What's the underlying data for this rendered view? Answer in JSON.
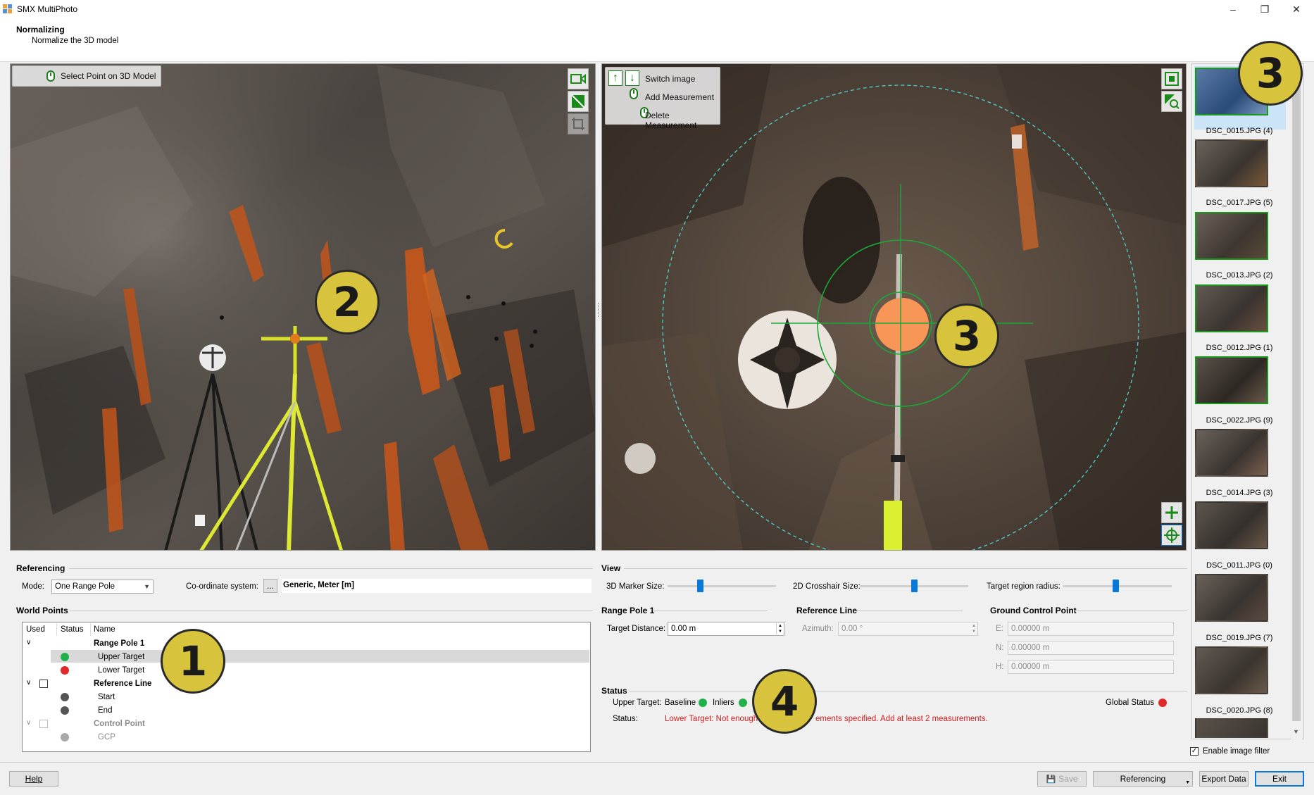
{
  "window": {
    "title": "SMX MultiPhoto"
  },
  "header": {
    "title": "Normalizing",
    "subtitle": "Normalize the 3D model"
  },
  "left_view": {
    "hint": "Select Point on 3D Model"
  },
  "right_view": {
    "hints": [
      "Switch image",
      "Add Measurement",
      "Delete Measurement"
    ]
  },
  "callouts": {
    "c1": "1",
    "c2": "2",
    "c3a": "3",
    "c3b": "3",
    "c4": "4"
  },
  "referencing": {
    "section": "Referencing",
    "mode_label": "Mode:",
    "mode_value": "One Range Pole",
    "coord_label": "Co-ordinate system:",
    "coord_btn": "...",
    "coord_value": "Generic, Meter [m]"
  },
  "world_points": {
    "section": "World Points",
    "columns": [
      "Used",
      "Status",
      "Name"
    ],
    "rows": [
      {
        "name": "Range Pole 1"
      },
      {
        "name": "Upper Target"
      },
      {
        "name": "Lower Target"
      },
      {
        "name": "Reference Line"
      },
      {
        "name": "Start"
      },
      {
        "name": "End"
      },
      {
        "name": "Control Point"
      },
      {
        "name": "GCP"
      }
    ]
  },
  "view": {
    "section": "View",
    "marker_label": "3D Marker Size:",
    "crosshair_label": "2D Crosshair Size:",
    "radius_label": "Target region radius:",
    "marker_level": 0.3,
    "crosshair_level": 0.5,
    "radius_level": 0.48
  },
  "range_pole": {
    "section": "Range Pole 1",
    "distance_label": "Target Distance:",
    "distance_value": "0.00 m"
  },
  "reference_line": {
    "section": "Reference Line",
    "azimuth_label": "Azimuth:",
    "azimuth_value": "0.00 °"
  },
  "gcp": {
    "section": "Ground Control Point",
    "e_label": "E:",
    "e_value": "0.00000 m",
    "n_label": "N:",
    "n_value": "0.00000 m",
    "h_label": "H:",
    "h_value": "0.00000 m"
  },
  "status": {
    "section": "Status",
    "upper_label": "Upper Target:",
    "baseline_label": "Baseline",
    "inliers_label": "Inliers",
    "global_label": "Global Status",
    "status_label": "Status:",
    "message": "Lower Target: Not enough",
    "message_tail": "ements specified. Add at least 2 measurements."
  },
  "thumbnails": [
    {
      "label": "DSC_0015.JPG (4)"
    },
    {
      "label": "DSC_0017.JPG (5)"
    },
    {
      "label": "DSC_0013.JPG (2)"
    },
    {
      "label": "DSC_0012.JPG (1)"
    },
    {
      "label": "DSC_0022.JPG (9)"
    },
    {
      "label": "DSC_0014.JPG (3)"
    },
    {
      "label": "DSC_0011.JPG (0)"
    },
    {
      "label": "DSC_0019.JPG (7)"
    },
    {
      "label": "DSC_0020.JPG (8)"
    }
  ],
  "image_filter": {
    "label": "Enable image filter",
    "checked": true
  },
  "footer": {
    "help": "Help",
    "save": "Save",
    "referencing": "Referencing",
    "export": "Export Data",
    "exit": "Exit"
  },
  "colors": {
    "accent_green": "#1fb14a",
    "error_red": "#d02020",
    "callout": "#d8c43c"
  }
}
